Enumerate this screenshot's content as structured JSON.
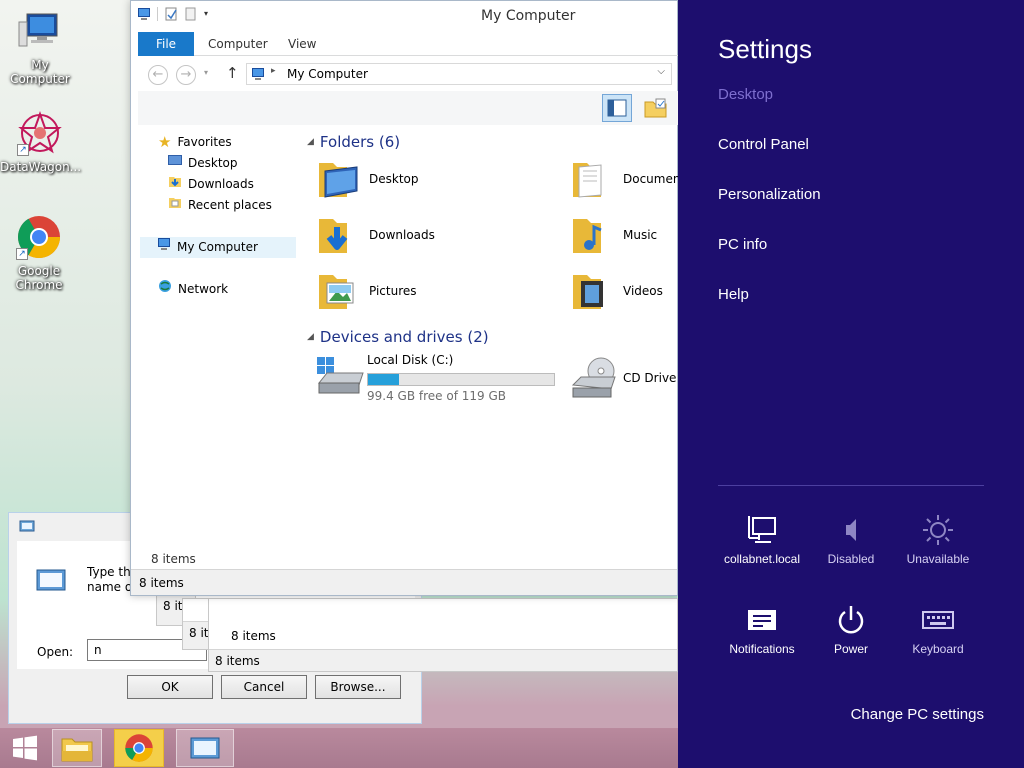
{
  "desktop": {
    "icons": [
      {
        "label": "My Computer",
        "icon": "computer-icon"
      },
      {
        "label": "DataWagon...",
        "icon": "datawagon-icon"
      },
      {
        "label": "Google Chrome",
        "icon": "chrome-icon"
      }
    ]
  },
  "run_dialog": {
    "prompt": "Type the name of a program, folder, document, or Internet resource,",
    "open_label": "Open:",
    "open_value": "n",
    "ok_label": "OK",
    "cancel_label": "Cancel",
    "browse_label": "Browse..."
  },
  "ghost_windows": [
    {
      "status": "8 it"
    },
    {
      "status": "8 it"
    },
    {
      "count": "8 items",
      "status": "8 items"
    }
  ],
  "explorer": {
    "title": "My Computer",
    "tabs": {
      "file": "File",
      "computer": "Computer",
      "view": "View"
    },
    "address": "My Computer",
    "nav": {
      "favorites": "Favorites",
      "desktop": "Desktop",
      "downloads": "Downloads",
      "recent": "Recent places",
      "my_computer": "My Computer",
      "network": "Network"
    },
    "folders_header": "Folders (6)",
    "folders": [
      "Desktop",
      "Documents",
      "Downloads",
      "Music",
      "Pictures",
      "Videos"
    ],
    "drives_header": "Devices and drives (2)",
    "drives": {
      "local_name": "Local Disk (C:)",
      "local_free": "99.4 GB free of 119 GB",
      "local_used_fraction": 0.165,
      "cd_name": "CD Drive (D:)"
    },
    "items_count": "8 items",
    "status": "8 items"
  },
  "settings": {
    "title": "Settings",
    "context": "Desktop",
    "links": {
      "control_panel": "Control Panel",
      "personalization": "Personalization",
      "pc_info": "PC info",
      "help": "Help"
    },
    "tiles": {
      "network": "collabnet.local",
      "volume": "Disabled",
      "brightness": "Unavailable",
      "notifications": "Notifications",
      "power": "Power",
      "keyboard": "Keyboard"
    },
    "change": "Change PC settings",
    "accent": "#1d0e6e"
  },
  "taskbar": {
    "buttons": [
      "start-button",
      "file-explorer",
      "google-chrome",
      "run-dialog"
    ]
  }
}
